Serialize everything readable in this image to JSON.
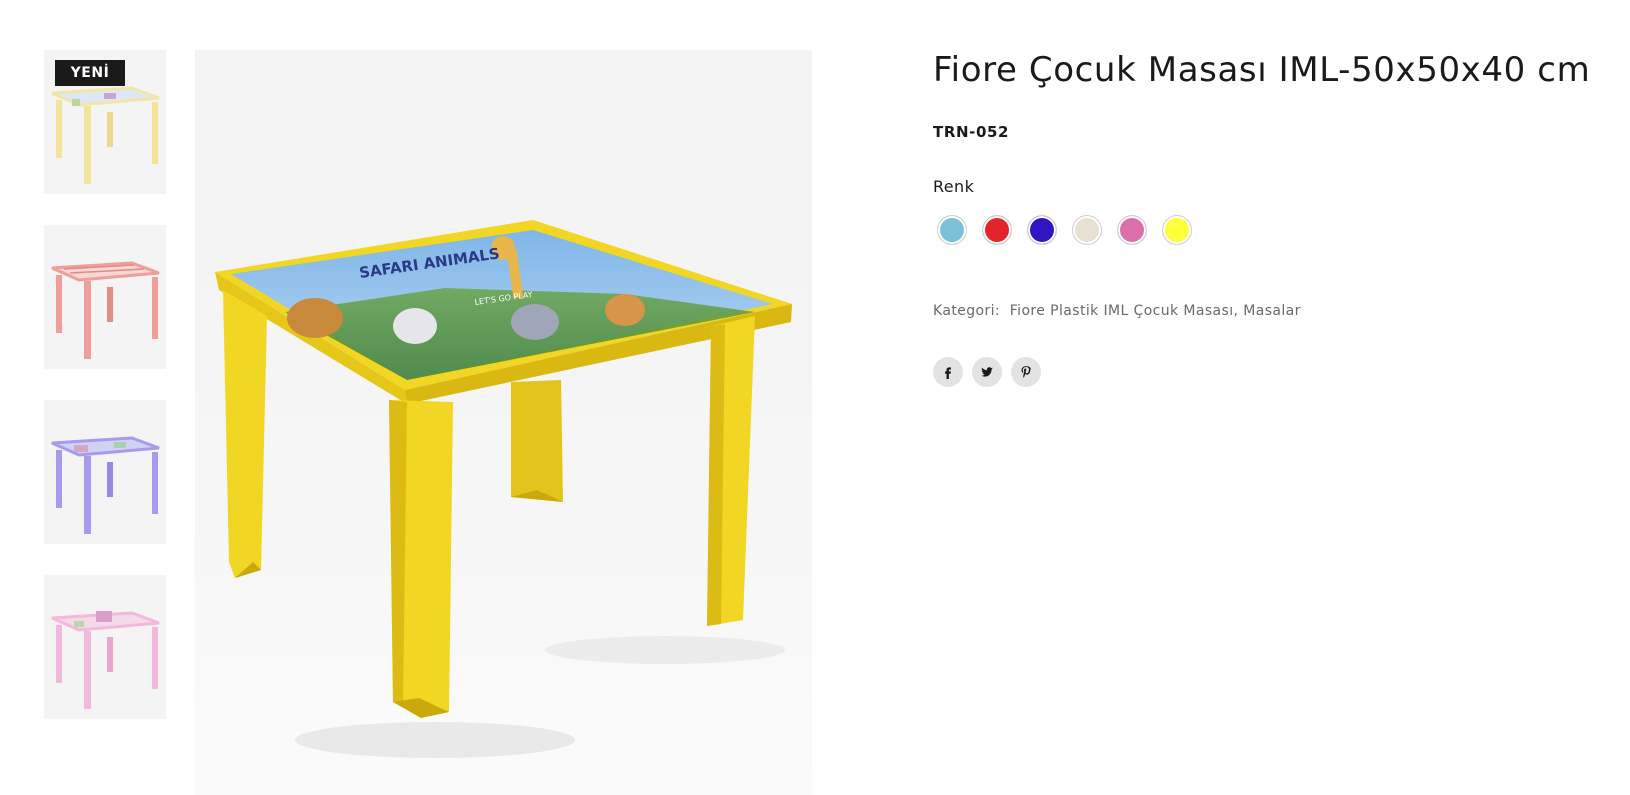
{
  "gallery": {
    "badge": "YENİ",
    "thumbnails": [
      {
        "color_name": "yellow",
        "leg": "#f2e49a",
        "top": "#f1e6a8"
      },
      {
        "color_name": "red",
        "leg": "#ef9e9a",
        "top": "#f6d8d2"
      },
      {
        "color_name": "purple",
        "leg": "#a99af0",
        "top": "#cfd3f2"
      },
      {
        "color_name": "pink",
        "leg": "#f3b8dc",
        "top": "#f4d9ea"
      }
    ],
    "main_image": {
      "table_color": "#f1d623",
      "table_shadow": "#d2b40f",
      "print_text": "SAFARI ANIMALS",
      "print_subtext": "LET'S GO PLAY"
    }
  },
  "product": {
    "title": "Fiore Çocuk Masası IML-50x50x40 cm",
    "sku": "TRN-052",
    "color_label": "Renk",
    "colors": [
      {
        "name": "light-blue",
        "hex": "#7cc0d8"
      },
      {
        "name": "red",
        "hex": "#e1252a"
      },
      {
        "name": "blue",
        "hex": "#2f14c2"
      },
      {
        "name": "cream",
        "hex": "#e8e1d1"
      },
      {
        "name": "pink",
        "hex": "#de6fae"
      },
      {
        "name": "yellow",
        "hex": "#ffff3a"
      }
    ],
    "category_label": "Kategori:",
    "categories": [
      "Fiore Plastik IML Çocuk Masası",
      "Masalar"
    ],
    "category_separator": ", "
  },
  "share": {
    "icons": [
      "facebook-icon",
      "twitter-icon",
      "pinterest-icon"
    ]
  }
}
